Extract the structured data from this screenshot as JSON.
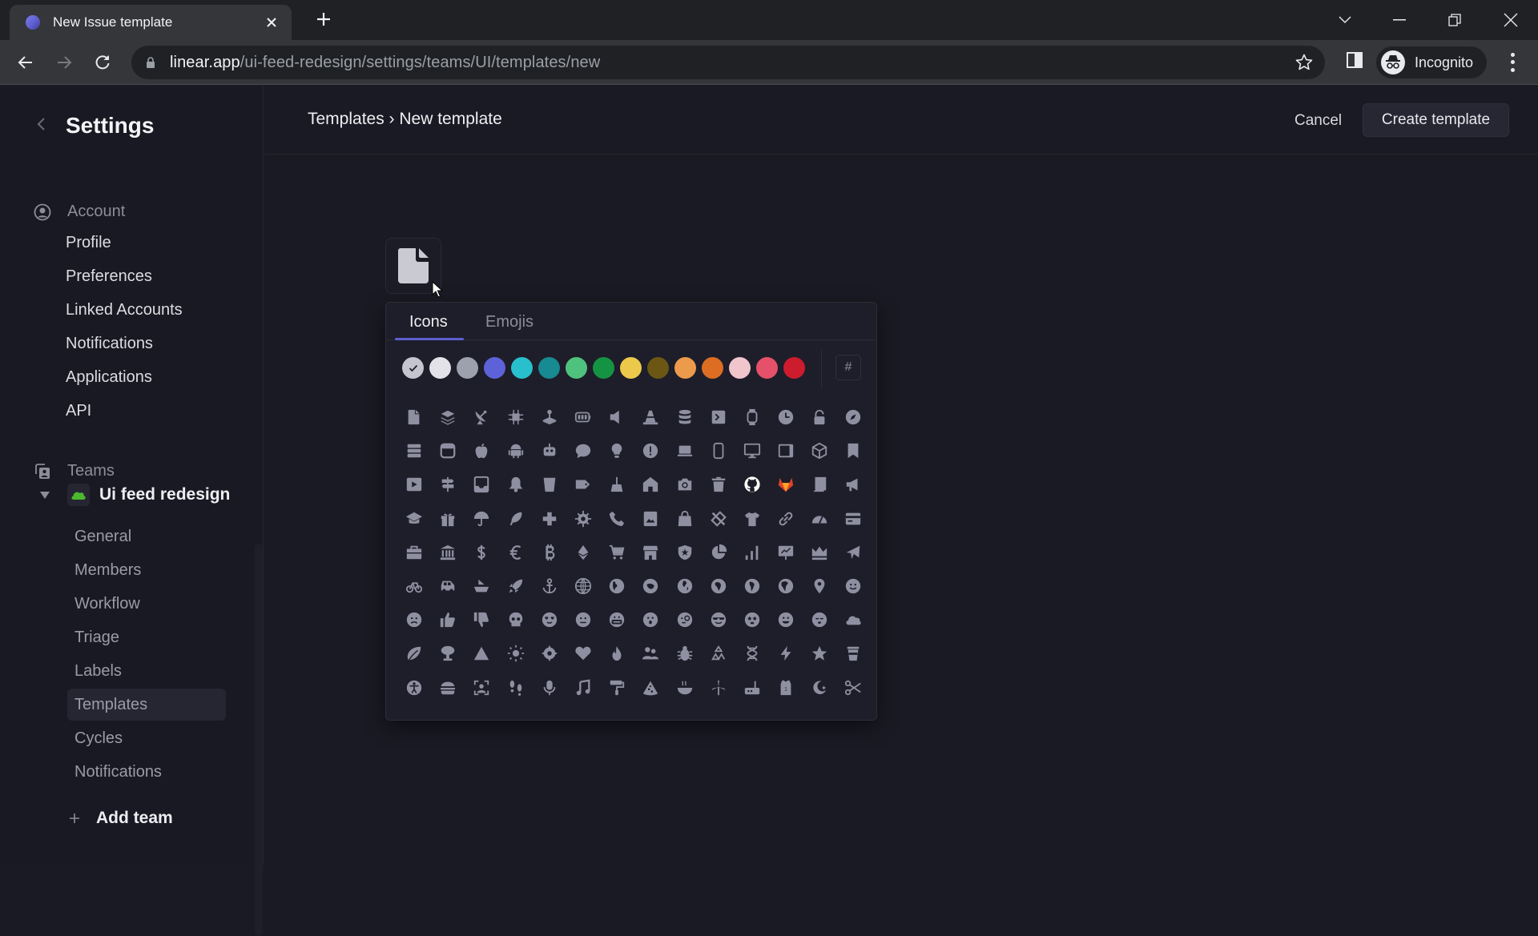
{
  "browser": {
    "tab_title": "New Issue template",
    "url_host": "linear.app",
    "url_path": "/ui-feed-redesign/settings/teams/UI/templates/new",
    "profile_label": "Incognito"
  },
  "sidebar": {
    "title": "Settings",
    "account_section": "Account",
    "account_items": [
      {
        "label": "Profile"
      },
      {
        "label": "Preferences"
      },
      {
        "label": "Linked Accounts"
      },
      {
        "label": "Notifications"
      },
      {
        "label": "Applications"
      },
      {
        "label": "API"
      }
    ],
    "teams_section": "Teams",
    "team": {
      "name": "Ui feed redesign",
      "icon": "cloud-icon",
      "icon_color": "#4cb82d",
      "items": [
        {
          "label": "General",
          "active": false
        },
        {
          "label": "Members",
          "active": false
        },
        {
          "label": "Workflow",
          "active": false
        },
        {
          "label": "Triage",
          "active": false
        },
        {
          "label": "Labels",
          "active": false
        },
        {
          "label": "Templates",
          "active": true
        },
        {
          "label": "Cycles",
          "active": false
        },
        {
          "label": "Notifications",
          "active": false
        }
      ]
    },
    "add_team_label": "Add team"
  },
  "header": {
    "breadcrumb": "Templates › New template",
    "cancel_label": "Cancel",
    "create_label": "Create template"
  },
  "template_icon": "document-icon",
  "picker": {
    "tabs": [
      {
        "label": "Icons",
        "active": true
      },
      {
        "label": "Emojis",
        "active": false
      }
    ],
    "accent": "#5e5ed0",
    "colors": [
      {
        "hex": "#c4c5ce",
        "selected": true
      },
      {
        "hex": "#e2e2e8",
        "selected": false
      },
      {
        "hex": "#9da0ad",
        "selected": false
      },
      {
        "hex": "#5e62d8",
        "selected": false
      },
      {
        "hex": "#27c0cc",
        "selected": false
      },
      {
        "hex": "#178a92",
        "selected": false
      },
      {
        "hex": "#4fc27e",
        "selected": false
      },
      {
        "hex": "#149443",
        "selected": false
      },
      {
        "hex": "#ecc94b",
        "selected": false
      },
      {
        "hex": "#6b5713",
        "selected": false
      },
      {
        "hex": "#ec9a4b",
        "selected": false
      },
      {
        "hex": "#dc6d22",
        "selected": false
      },
      {
        "hex": "#f0c6cc",
        "selected": false
      },
      {
        "hex": "#e5506a",
        "selected": false
      },
      {
        "hex": "#cc1c2e",
        "selected": false
      }
    ],
    "custom_color_label": "#",
    "icon_color": "#8e8fa0",
    "icons": [
      "document",
      "layers",
      "satellite-dish",
      "chip",
      "joystick",
      "battery",
      "speaker",
      "traffic-cone",
      "database",
      "terminal",
      "smartwatch",
      "clock",
      "lock",
      "compass",
      "server",
      "browser-window",
      "apple",
      "android",
      "robot",
      "chat-bubble",
      "lightbulb",
      "alert-circle",
      "laptop",
      "smartphone",
      "desktop",
      "tablet",
      "cube",
      "bookmark",
      "video-play",
      "signpost",
      "inbox",
      "bell",
      "cup",
      "tag",
      "broom",
      "house",
      "camera",
      "trash",
      "github",
      "gitlab",
      "book",
      "megaphone",
      "graduation-cap",
      "gift",
      "umbrella",
      "feather",
      "medical-cross",
      "gear",
      "phone",
      "picture-frame",
      "shopping-bag",
      "tools",
      "t-shirt",
      "link",
      "speedometer",
      "credit-card",
      "briefcase",
      "bank",
      "dollar",
      "euro",
      "bitcoin",
      "ethereum",
      "shopping-cart",
      "storefront",
      "police-badge",
      "pie-chart",
      "bar-chart",
      "presentation",
      "crown",
      "airplane",
      "bicycle",
      "car",
      "ship",
      "rocket",
      "anchor",
      "globe-grid",
      "globe-asia",
      "globe-australia",
      "globe-europe",
      "globe-africa",
      "globe-south-america",
      "globe-north-america",
      "map-pin",
      "smile",
      "frown",
      "thumbs-up",
      "thumbs-down",
      "skull",
      "heart-eyes",
      "neutral-face",
      "mask-face",
      "surprised-face",
      "monocle-face",
      "sunglasses-face",
      "star-eyes",
      "tongue-face",
      "sleepy-face",
      "cloud",
      "leaf",
      "mushroom-cloud",
      "mountain",
      "sun",
      "flower",
      "heart",
      "flame",
      "people",
      "bug",
      "recycle",
      "dna",
      "lightning",
      "star",
      "coffee-cup",
      "accessibility",
      "burger",
      "face-scan",
      "footprints",
      "microphone",
      "music-note",
      "paint-roller",
      "pizza",
      "noodle-bowl",
      "wind-turbine",
      "router",
      "jersey",
      "moon-star",
      "scissors"
    ]
  }
}
